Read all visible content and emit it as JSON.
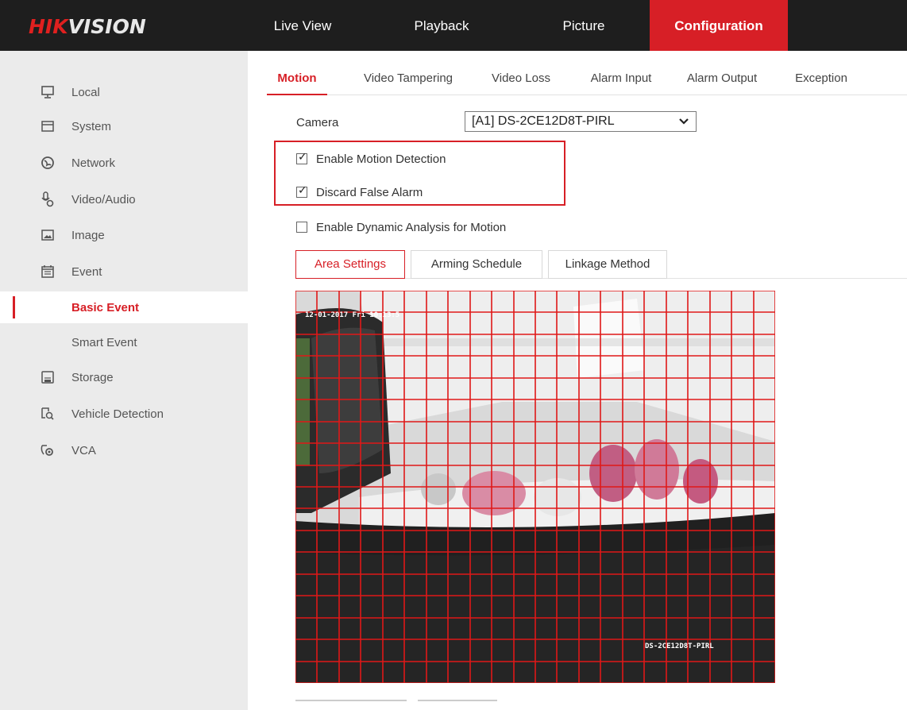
{
  "brand": {
    "part1": "HIK",
    "part2": "VISION",
    "accent": "#d71f26"
  },
  "nav": {
    "live_view": "Live View",
    "playback": "Playback",
    "picture": "Picture",
    "configuration": "Configuration"
  },
  "sidebar": {
    "local": "Local",
    "system": "System",
    "network": "Network",
    "video_audio": "Video/Audio",
    "image": "Image",
    "event": "Event",
    "basic_event": "Basic Event",
    "smart_event": "Smart Event",
    "storage": "Storage",
    "vehicle_detection": "Vehicle Detection",
    "vca": "VCA"
  },
  "tabs": {
    "motion": "Motion",
    "video_tampering": "Video Tampering",
    "video_loss": "Video Loss",
    "alarm_input": "Alarm Input",
    "alarm_output": "Alarm Output",
    "exception": "Exception"
  },
  "camera": {
    "label": "Camera",
    "selected": "[A1] DS-2CE12D8T-PIRL"
  },
  "options": {
    "enable_motion": {
      "label": "Enable Motion Detection",
      "checked": true
    },
    "discard_false": {
      "label": "Discard False Alarm",
      "checked": true
    },
    "dynamic_analysis": {
      "label": "Enable Dynamic Analysis for Motion",
      "checked": false
    }
  },
  "subtabs": {
    "area_settings": "Area Settings",
    "arming_schedule": "Arming Schedule",
    "linkage_method": "Linkage Method"
  },
  "video": {
    "timestamp": "12-01-2017 Fri 10:13:5",
    "camera_name": "DS-2CE12D8T-PIRL"
  }
}
